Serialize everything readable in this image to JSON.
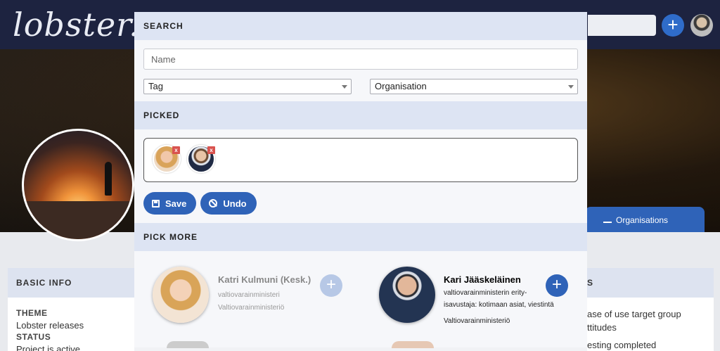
{
  "app": {
    "logo": "lobster."
  },
  "background": {
    "tabs": {
      "organisations": "Organisations"
    },
    "basic_info": {
      "title": "BASIC INFO",
      "theme_label": "THEME",
      "theme_value": "Lobster releases",
      "status_label": "STATUS",
      "status_value": "Project is active"
    },
    "right_card": {
      "title": "S",
      "line1": "ase of use target group",
      "line2": "ttitudes",
      "line3": "esting completed"
    }
  },
  "modal": {
    "search": {
      "title": "SEARCH",
      "name_placeholder": "Name",
      "tag_select": "Tag",
      "org_select": "Organisation"
    },
    "picked": {
      "title": "PICKED",
      "remove_label": "x",
      "save_label": "Save",
      "undo_label": "Undo"
    },
    "pick_more": {
      "title": "PICK MORE",
      "people": [
        {
          "name": "Katri Kulmuni (Kesk.)",
          "role_lines": [
            "valtiovarainministeri"
          ],
          "organisation": "Valtiovarainministeriö",
          "add_label": "+",
          "added": true
        },
        {
          "name": "Kari Jääskeläinen",
          "role_lines": [
            "valtiovarainministerin erity-",
            "isavustaja: kotimaan asiat, viestintä"
          ],
          "organisation": "Valtiovarainministeriö",
          "add_label": "+",
          "added": false
        }
      ]
    }
  },
  "colors": {
    "primary": "#2f63b8",
    "primary_disabled": "#b7c8e6",
    "topbar": "#1d2340",
    "section_header": "#dde4f3",
    "remove_badge": "#d9534f"
  },
  "icons": {
    "top_add": "plus-icon",
    "save": "floppy-icon",
    "undo": "ban-icon",
    "remove": "close-icon",
    "org_tab": "factory-icon",
    "select_caret": "caret-down-icon"
  }
}
